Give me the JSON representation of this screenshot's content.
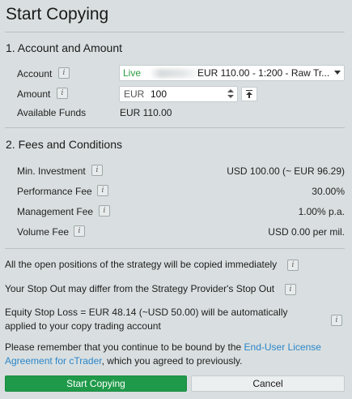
{
  "title": "Start Copying",
  "section1": {
    "title": "1. Account and Amount",
    "account_label": "Account",
    "account_live": "Live",
    "account_value": "EUR 110.00 - 1:200 - Raw Tr...",
    "amount_label": "Amount",
    "amount_currency": "EUR",
    "amount_value": "100",
    "available_label": "Available Funds",
    "available_value": "EUR 110.00"
  },
  "section2": {
    "title": "2. Fees and Conditions",
    "rows": [
      {
        "label": "Min. Investment",
        "value": "USD 100.00 (~ EUR 96.29)"
      },
      {
        "label": "Performance Fee",
        "value": "30.00%"
      },
      {
        "label": "Management Fee",
        "value": "1.00% p.a."
      },
      {
        "label": "Volume Fee",
        "value": "USD 0.00 per mil."
      }
    ]
  },
  "notes": {
    "positions": "All the open positions of the strategy will be copied immediately",
    "stop_out": "Your Stop Out may differ from the Strategy Provider's Stop Out",
    "equity_line1": "Equity Stop Loss = EUR 48.14 (~USD 50.00) will be automatically",
    "equity_line2": "applied to your copy trading account",
    "license_pre": "Please remember that you continue to be bound by the ",
    "license_link1": "End-User License",
    "license_link2": "Agreement for cTrader",
    "license_post": ", which you agreed to previously."
  },
  "buttons": {
    "start": "Start Copying",
    "cancel": "Cancel"
  },
  "info_icon_glyph": "i",
  "colors": {
    "accent_green": "#1f9a4a",
    "live_green": "#2a9a3e",
    "link_blue": "#2c86c9",
    "background": "#d9dfe0"
  }
}
